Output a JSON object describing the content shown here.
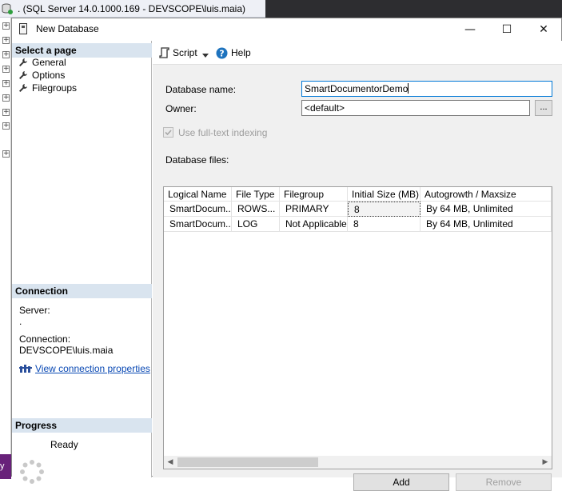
{
  "background": {
    "window_title": ". (SQL Server 14.0.1000.169 - DEVSCOPE\\luis.maia)",
    "left_edge_text": "y"
  },
  "dialog": {
    "title": "New Database",
    "minimize": "—",
    "maximize": "☐",
    "close": "✕"
  },
  "left_panel": {
    "select_page_header": "Select a page",
    "pages": [
      {
        "label": "General",
        "icon": "wrench-icon"
      },
      {
        "label": "Options",
        "icon": "wrench-icon"
      },
      {
        "label": "Filegroups",
        "icon": "wrench-icon"
      }
    ],
    "connection_header": "Connection",
    "server_label": "Server:",
    "server_value": ".",
    "connection_label": "Connection:",
    "connection_value": "DEVSCOPE\\luis.maia",
    "view_props_link": "View connection properties",
    "progress_header": "Progress",
    "progress_status": "Ready"
  },
  "toolbar": {
    "script_label": "Script",
    "help_label": "Help"
  },
  "form": {
    "db_name_label": "Database name:",
    "db_name_value": "SmartDocumentorDemo",
    "owner_label": "Owner:",
    "owner_value": "<default>",
    "browse_label": "...",
    "fulltext_label": "Use full-text indexing",
    "fulltext_checked": true,
    "db_files_label": "Database files:"
  },
  "grid": {
    "columns": [
      "Logical Name",
      "File Type",
      "Filegroup",
      "Initial Size (MB)",
      "Autogrowth / Maxsize"
    ],
    "rows": [
      [
        "SmartDocum...",
        "ROWS...",
        "PRIMARY",
        "8",
        "By 64 MB, Unlimited"
      ],
      [
        "SmartDocum...",
        "LOG",
        "Not Applicable",
        "8",
        "By 64 MB, Unlimited"
      ]
    ]
  },
  "buttons": {
    "add": "Add",
    "remove": "Remove"
  },
  "colors": {
    "section_header": "#d9e4ef",
    "link": "#0a49b4",
    "focus_border": "#0078d7",
    "vs_purple": "#68217a"
  }
}
